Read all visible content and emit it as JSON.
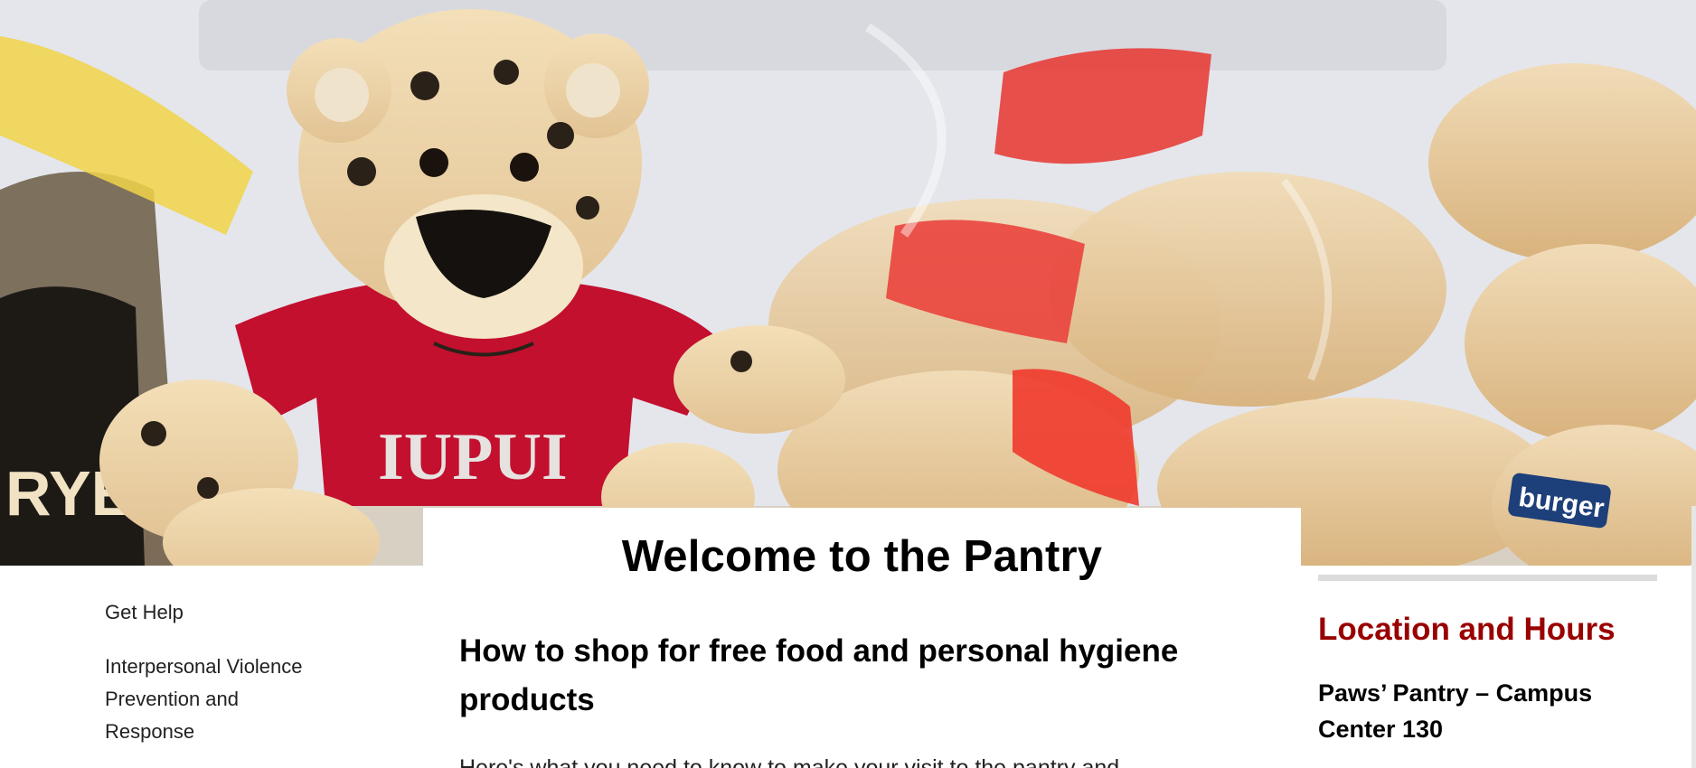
{
  "hero": {
    "shirt_text": "IUPUI",
    "bag_text_1": "burger",
    "bag_text_2": "RYE"
  },
  "main": {
    "title": "Welcome to the Pantry",
    "section_heading": "How to shop for free food and personal hygiene products",
    "intro_partial": "Here's what you need to know to make your visit to the pantry and"
  },
  "sidebar": {
    "items": [
      {
        "label": "Get Help"
      },
      {
        "label": "Interpersonal Violence Prevention and Response"
      }
    ]
  },
  "info_panel": {
    "heading": "Location and Hours",
    "location": "Paws’ Pantry – Campus Center 130"
  },
  "colors": {
    "accent": "#990000",
    "shirt": "#c3102f",
    "rule": "#dcdcdc"
  }
}
